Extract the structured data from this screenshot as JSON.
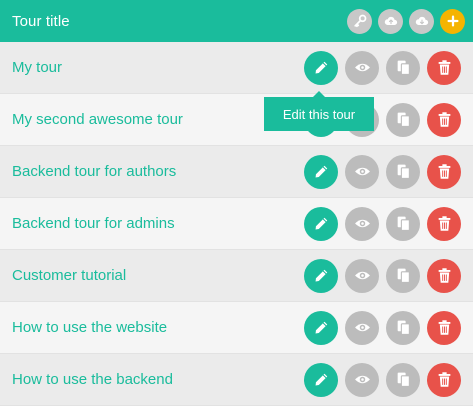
{
  "header": {
    "title": "Tour title",
    "actions": [
      "key-icon",
      "cloud-upload-icon",
      "cloud-download-icon",
      "plus-icon"
    ],
    "add_color": "#f5b400"
  },
  "tours": [
    {
      "title": "My tour"
    },
    {
      "title": "My second awesome tour"
    },
    {
      "title": "Backend tour for authors"
    },
    {
      "title": "Backend tour for admins"
    },
    {
      "title": "Customer tutorial"
    },
    {
      "title": "How to use the website"
    },
    {
      "title": "How to use the backend"
    }
  ],
  "row_actions": [
    "pencil-icon",
    "eye-icon",
    "copy-icon",
    "trash-icon"
  ],
  "tooltip": {
    "text": "Edit this tour"
  },
  "colors": {
    "accent": "#1abc9c",
    "neutral": "#bcbcbc",
    "danger": "#e8524a"
  }
}
